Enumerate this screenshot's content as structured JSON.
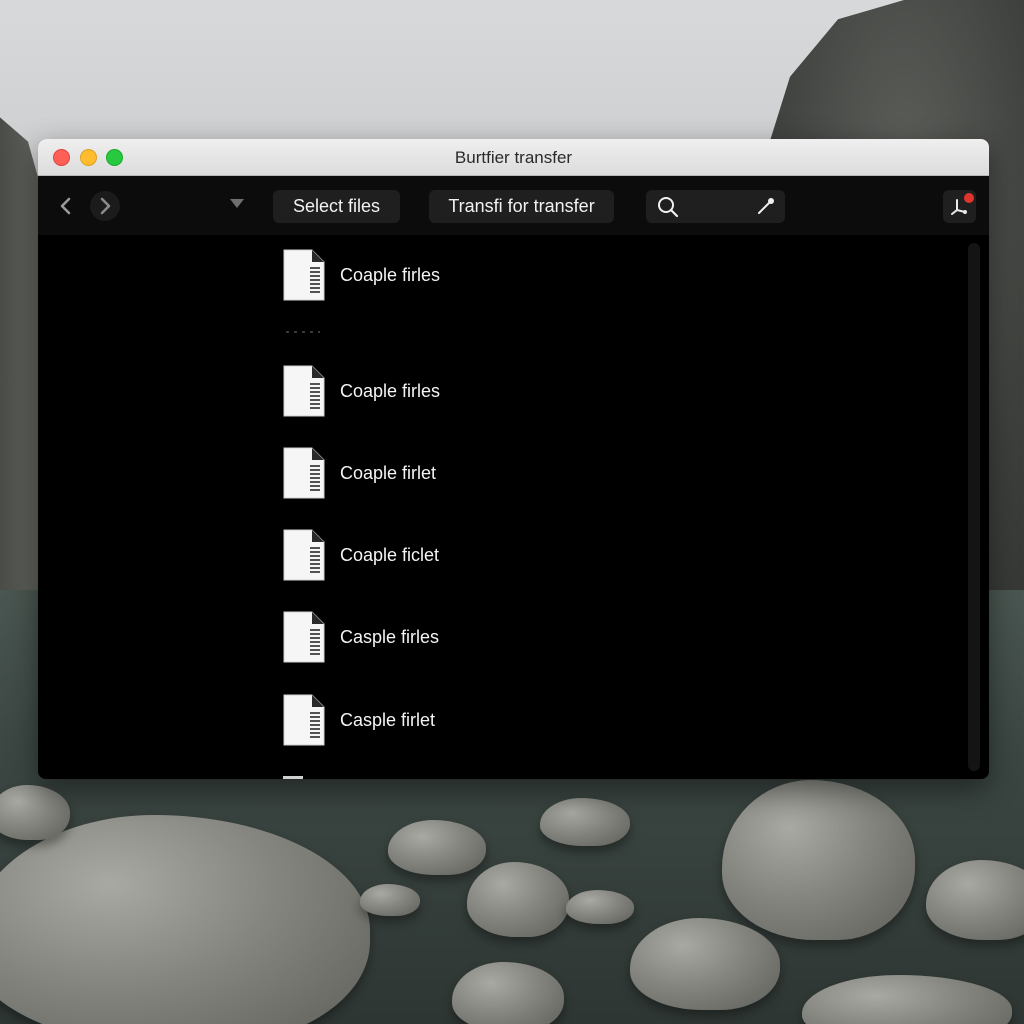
{
  "window": {
    "title": "Burtfier transfer"
  },
  "toolbar": {
    "select_label": "Select files",
    "transfer_label": "Transfi for transfer",
    "search_value": ""
  },
  "files": [
    {
      "name": "Coaple firles",
      "icon": "document-icon"
    },
    {
      "name": "Coaple firles",
      "icon": "document-icon"
    },
    {
      "name": "Coaple firlet",
      "icon": "document-icon"
    },
    {
      "name": "Coaple ficlet",
      "icon": "document-icon"
    },
    {
      "name": "Casple firles",
      "icon": "document-icon"
    },
    {
      "name": "Casple firlet",
      "icon": "document-icon"
    }
  ],
  "colors": {
    "close": "#fe5f57",
    "minimize": "#febc2e",
    "maximize": "#28c840",
    "notification_badge": "#e0342d",
    "content_background": "#000000"
  }
}
